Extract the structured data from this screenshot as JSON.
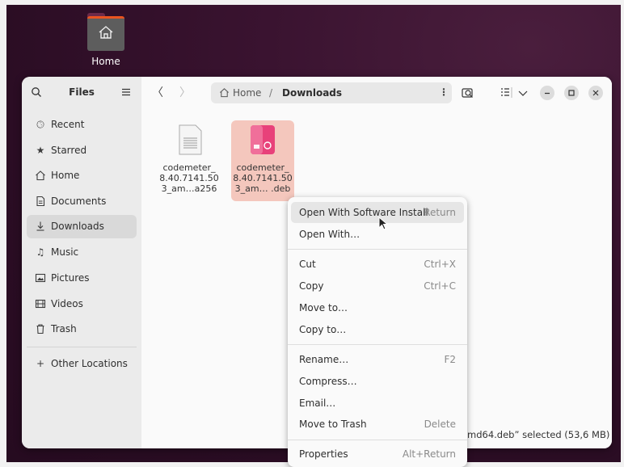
{
  "desktop": {
    "home_label": "Home"
  },
  "sidebar": {
    "title": "Files",
    "items": [
      {
        "label": "Recent",
        "icon": "clock-icon"
      },
      {
        "label": "Starred",
        "icon": "star-icon"
      },
      {
        "label": "Home",
        "icon": "home-icon"
      },
      {
        "label": "Documents",
        "icon": "document-icon"
      },
      {
        "label": "Downloads",
        "icon": "download-icon",
        "active": true
      },
      {
        "label": "Music",
        "icon": "music-icon"
      },
      {
        "label": "Pictures",
        "icon": "picture-icon"
      },
      {
        "label": "Videos",
        "icon": "film-icon"
      },
      {
        "label": "Trash",
        "icon": "trash-icon"
      }
    ],
    "other_locations": "Other Locations",
    "other_locations_prefix": "+"
  },
  "header": {
    "back": "〈",
    "forward": "〉",
    "path_home": "Home",
    "path_sep": "/",
    "path_current": "Downloads",
    "more": "⋮"
  },
  "files": [
    {
      "line1": "codemeter_",
      "line2": "8.40.7141.50",
      "line3": "3_am…a256",
      "type": "document"
    },
    {
      "line1": "codemeter_",
      "line2": "8.40.7141.50",
      "line3": "3_am… .deb",
      "type": "deb",
      "selected": true
    }
  ],
  "status": "md64.deb” selected (53,6 MB)",
  "context_menu": {
    "items": [
      {
        "label": "Open With Software Install",
        "accel": "Return"
      },
      {
        "label": "Open With…",
        "accel": ""
      },
      {
        "label": "Cut",
        "accel": "Ctrl+X"
      },
      {
        "label": "Copy",
        "accel": "Ctrl+C"
      },
      {
        "label": "Move to…",
        "accel": ""
      },
      {
        "label": "Copy to…",
        "accel": ""
      },
      {
        "label": "Rename…",
        "accel": "F2"
      },
      {
        "label": "Compress…",
        "accel": ""
      },
      {
        "label": "Email…",
        "accel": ""
      },
      {
        "label": "Move to Trash",
        "accel": "Delete"
      },
      {
        "label": "Properties",
        "accel": "Alt+Return"
      }
    ]
  },
  "colors": {
    "accent": "#e95420",
    "selection": "#f4c7bd",
    "deb_pink": "#e8417a"
  }
}
